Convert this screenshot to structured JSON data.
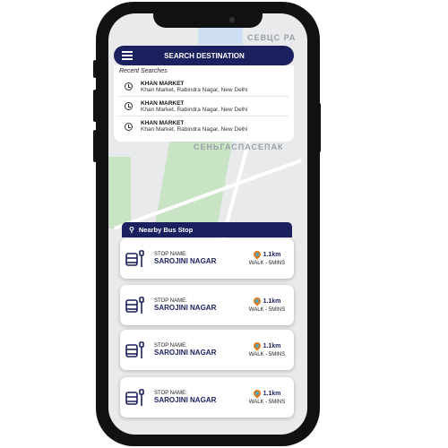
{
  "search": {
    "title": "SEARCH DESTINATION"
  },
  "recent": {
    "title": "Recent Searches",
    "items": [
      {
        "name": "KHAN MARKET",
        "address": "Khan Market, Rabindra Nagar, New Delhi"
      },
      {
        "name": "KHAN MARKET",
        "address": "Khan Market, Rabindra Nagar, New Delhi"
      },
      {
        "name": "KHAN MARKET",
        "address": "Khan Market, Rabindra Nagar, New Delhi"
      }
    ]
  },
  "nearby": {
    "title": "Nearby Bus Stop",
    "stops": [
      {
        "label": "STOP NAME:",
        "name": "SAROJINI NAGAR",
        "distance": "1.1km",
        "walk": "WALK - 5MINS"
      },
      {
        "label": "STOP NAME:",
        "name": "SAROJINI NAGAR",
        "distance": "1.1km",
        "walk": "WALK - 5MINS"
      },
      {
        "label": "STOP NAME:",
        "name": "SAROJINI NAGAR",
        "distance": "1.1km",
        "walk": "WALK - 5MINS"
      },
      {
        "label": "STOP NAME:",
        "name": "SAROJINI NAGAR",
        "distance": "1.1km",
        "walk": "WALK - 5MINS"
      }
    ]
  },
  "map": {
    "labels": [
      "СЕНЬГАСПАСЕПАК",
      "СЕВЦС РА"
    ]
  },
  "colors": {
    "primary": "#1b205f",
    "pin": "#e07b1a"
  }
}
